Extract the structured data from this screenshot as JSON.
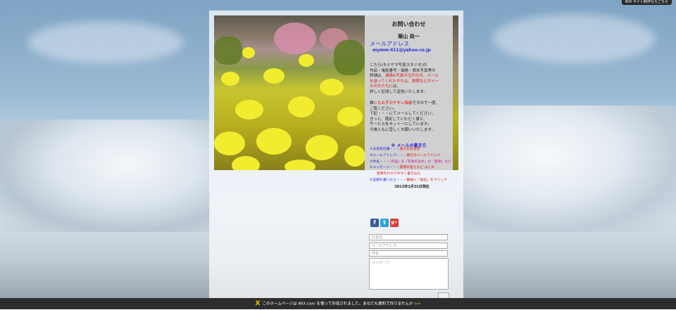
{
  "wix_badge": "WIX サイト制作ならこちら",
  "contact": {
    "title": "お問い合わせ",
    "author": "築山 政一",
    "mail_heading": "メールアドレス",
    "mail_address": "mymm:411@yahoo.co.jp",
    "para1_a": "こちら(モミヤマ写真スタジオ)の",
    "para1_b": "作品・電話番号・価格・資本写真等の",
    "para1_c": "詳細は、",
    "para1_red": "連絡&写真の注文の方、メール",
    "para1_red2": "を送ってくれたかたも、質問などのメー",
    "para1_red3": "ルの方たちに",
    "para1_d": "は、",
    "para1_e": "詳しく記述して返信いたします。",
    "para2_a": "誰",
    "para2_red": "にもお手のやすい価格",
    "para2_b": "ですので一度、",
    "para2_c": "ご覧ください。",
    "para2_d": "下記・・・にてメールしてください。",
    "para2_e": "きっと、満足していただく事と、",
    "para2_f": "サービスをモットーにしています。",
    "para2_g": "今後ともに宜しくお願いいたします。",
    "rules_heading": "※ メールの書き方",
    "rules": [
      {
        "num": "①",
        "label": "お名前の欄",
        "sep": "・・・",
        "value": "貴方のお名前"
      },
      {
        "num": "②",
        "label": "メールアドレス",
        "sep": "・・・",
        "value": "貴方のメールアドレス"
      },
      {
        "num": "③",
        "label": "件名",
        "sep": "・・・",
        "value": "『作品』&『写真の注文』か『質問』など"
      },
      {
        "num": "④",
        "label": "メッセージ",
        "sep": "・・・",
        "value": "質問の答えなど まとめ"
      },
      {
        "num": "",
        "label": "",
        "sep": "",
        "value": "質問をわかりやすく書き込む"
      },
      {
        "num": "⑤",
        "label": "全部を書いたら",
        "sep": "・・・",
        "value": "最後に『送信』をクリック"
      }
    ],
    "date": "2013年1月31日現在"
  },
  "social": {
    "facebook": "f",
    "twitter": "t",
    "gplus": "g+"
  },
  "form": {
    "name_placeholder": "お名前",
    "email_placeholder": "メールアドレス",
    "subject_placeholder": "件名",
    "message_placeholder": "メッセージ"
  },
  "footer": {
    "logo": "X",
    "text": "このホームページは WIX.com を使って作成されました。あなたも無料で作りませんか",
    "go": ">>"
  }
}
